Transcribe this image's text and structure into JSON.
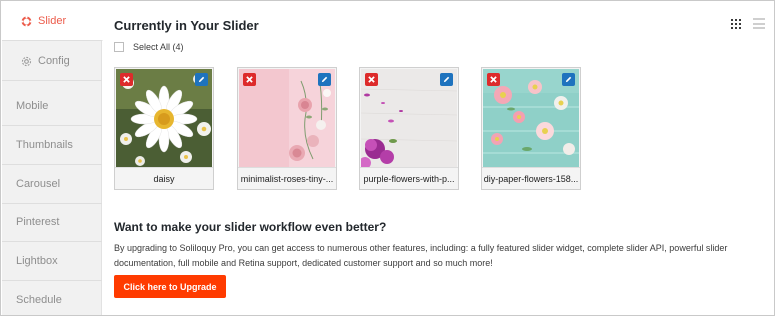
{
  "sidebar": {
    "items": [
      {
        "label": "Slider",
        "icon": "slider-icon",
        "active": true
      },
      {
        "label": "Config",
        "icon": "gear-icon",
        "active": false
      },
      {
        "label": "Mobile",
        "active": false
      },
      {
        "label": "Thumbnails",
        "active": false
      },
      {
        "label": "Carousel",
        "active": false
      },
      {
        "label": "Pinterest",
        "active": false
      },
      {
        "label": "Lightbox",
        "active": false
      },
      {
        "label": "Schedule",
        "active": false
      }
    ]
  },
  "main": {
    "title": "Currently in Your Slider",
    "view_modes": [
      "grid-view-icon",
      "list-view-icon"
    ],
    "select_all_label": "Select All (4)",
    "slides": [
      {
        "caption": "daisy"
      },
      {
        "caption": "minimalist-roses-tiny-..."
      },
      {
        "caption": "purple-flowers-with-p..."
      },
      {
        "caption": "diy-paper-flowers-158..."
      }
    ],
    "slide_actions": {
      "delete_icon": "close-icon",
      "edit_icon": "pencil-icon"
    }
  },
  "promo": {
    "title": "Want to make your slider workflow even better?",
    "text": "By upgrading to Soliloquy Pro, you can get access to numerous other features, including: a fully featured slider widget, complete slider API, powerful slider documentation, full mobile and Retina support, dedicated customer support and so much more!",
    "button_label": "Click here to Upgrade"
  },
  "colors": {
    "accent": "#ec5b4a",
    "upgrade_button": "#ff3b00",
    "delete_button": "#dd2b2b",
    "edit_button": "#1e73be"
  }
}
